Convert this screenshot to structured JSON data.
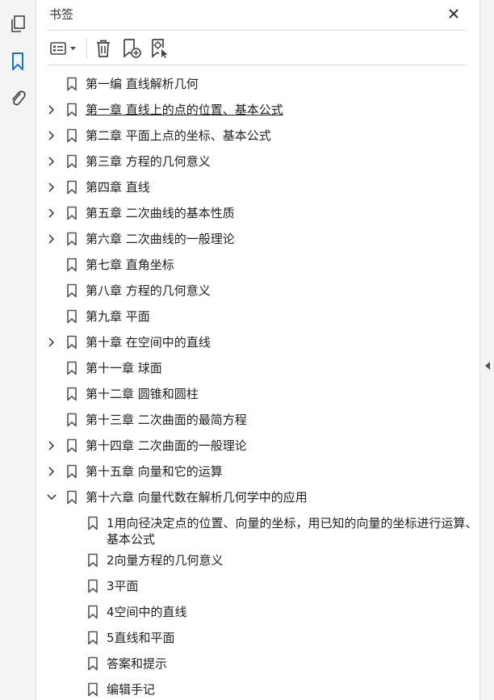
{
  "panel": {
    "title": "书签"
  },
  "icons": {
    "pages": "pages-icon",
    "bookmarks": "bookmark-icon",
    "attachments": "paperclip-icon",
    "close": "close-icon",
    "options": "list-options-icon",
    "delete": "trash-icon",
    "new_bookmark": "add-bookmark-icon",
    "find_bookmark": "find-bookmark-icon",
    "collapse": "collapse-panel-icon"
  },
  "colors": {
    "accent": "#1473e6",
    "icon": "#444444"
  },
  "bookmarks": [
    {
      "label": "第一编  直线解析几何",
      "expand": "",
      "level": 0
    },
    {
      "label": "第一章  直线上的点的位置、基本公式",
      "expand": "collapsed",
      "level": 0,
      "hover": true
    },
    {
      "label": "第二章  平面上点的坐标、基本公式",
      "expand": "collapsed",
      "level": 0
    },
    {
      "label": "第三章  方程的几何意义",
      "expand": "collapsed",
      "level": 0
    },
    {
      "label": "第四章  直线",
      "expand": "collapsed",
      "level": 0
    },
    {
      "label": "第五章  二次曲线的基本性质",
      "expand": "collapsed",
      "level": 0
    },
    {
      "label": "第六章  二次曲线的一般理论",
      "expand": "collapsed",
      "level": 0
    },
    {
      "label": "第七章  直角坐标",
      "expand": "",
      "level": 0
    },
    {
      "label": "第八章  方程的几何意义",
      "expand": "",
      "level": 0
    },
    {
      "label": "第九章  平面",
      "expand": "",
      "level": 0
    },
    {
      "label": "第十章  在空间中的直线",
      "expand": "collapsed",
      "level": 0
    },
    {
      "label": "第十一章  球面",
      "expand": "",
      "level": 0
    },
    {
      "label": "第十二章  圆锥和圆柱",
      "expand": "",
      "level": 0
    },
    {
      "label": "第十三章  二次曲面的最简方程",
      "expand": "",
      "level": 0
    },
    {
      "label": "第十四章  二次曲面的一般理论",
      "expand": "collapsed",
      "level": 0
    },
    {
      "label": "第十五章  向量和它的运算",
      "expand": "collapsed",
      "level": 0
    },
    {
      "label": "第十六章  向量代数在解析几何学中的应用",
      "expand": "expanded",
      "level": 0
    },
    {
      "label": "1用向径决定点的位置、向量的坐标，用已知的向量的坐标进行运算、基本公式",
      "expand": "",
      "level": 1,
      "tall": true
    },
    {
      "label": "2向量方程的几何意义",
      "expand": "",
      "level": 1
    },
    {
      "label": "3平面",
      "expand": "",
      "level": 1
    },
    {
      "label": "4空间中的直线",
      "expand": "",
      "level": 1
    },
    {
      "label": "5直线和平面",
      "expand": "",
      "level": 1
    },
    {
      "label": "答案和提示",
      "expand": "",
      "level": 1
    },
    {
      "label": "编辑手记",
      "expand": "",
      "level": 1
    }
  ]
}
